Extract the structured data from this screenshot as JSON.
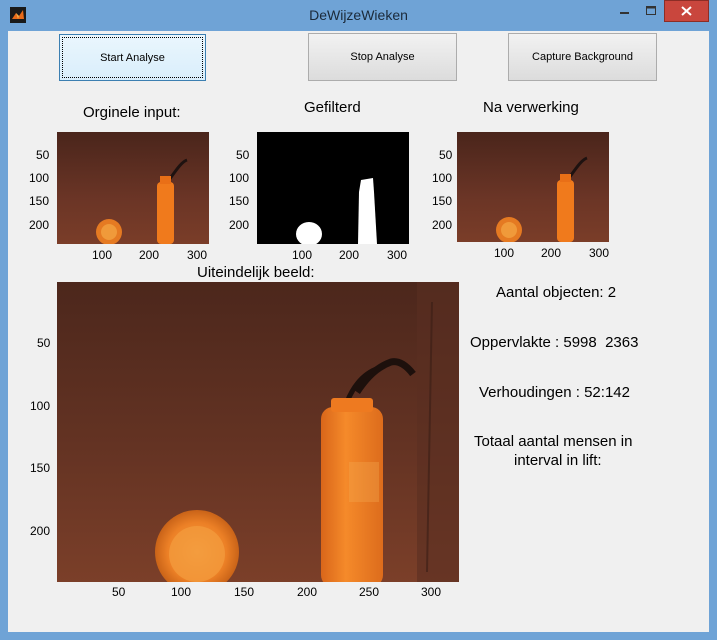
{
  "window": {
    "title": "DeWijzeWieken"
  },
  "buttons": {
    "start": "Start Analyse",
    "stop": "Stop Analyse",
    "capture": "Capture Background"
  },
  "panels": {
    "original": {
      "title": "Orginele input:"
    },
    "filtered": {
      "title": "Gefilterd"
    },
    "processed": {
      "title": "Na verwerking"
    },
    "final": {
      "title": "Uiteindelijk beeld:"
    }
  },
  "small_axes": {
    "y_ticks": [
      "50",
      "100",
      "150",
      "200"
    ],
    "x_ticks": [
      "100",
      "200",
      "300"
    ]
  },
  "big_axes": {
    "y_ticks": [
      "50",
      "100",
      "150",
      "200"
    ],
    "x_ticks": [
      "50",
      "100",
      "150",
      "200",
      "250",
      "300"
    ]
  },
  "stats": {
    "objects": "Aantal objecten: 2",
    "area": "Oppervlakte : 5998  2363",
    "ratio": "Verhoudingen : 52:142",
    "total_line1": "Totaal aantal mensen in",
    "total_line2": "interval in lift:"
  },
  "colors": {
    "accent": "#3c7fb1",
    "close": "#c9463d",
    "image_bg": "#5a3022",
    "bottle": "#f07a1c"
  }
}
